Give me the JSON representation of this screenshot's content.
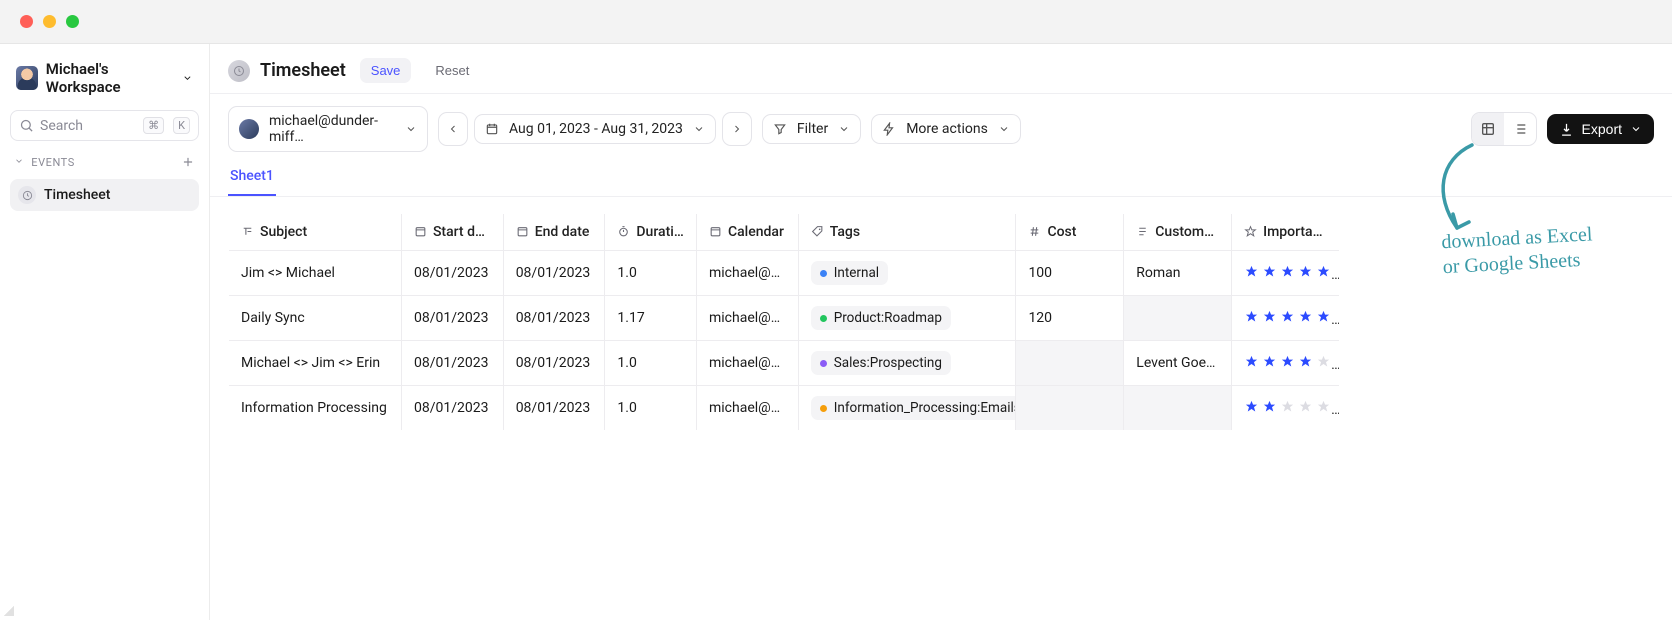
{
  "window": {
    "title": ""
  },
  "sidebar": {
    "workspace": "Michael's Workspace",
    "search_placeholder": "Search",
    "shortcut_mod": "⌘",
    "shortcut_key": "K",
    "section_label": "EVENTS",
    "items": [
      {
        "label": "Timesheet"
      }
    ]
  },
  "header": {
    "page_title": "Timesheet",
    "save_label": "Save",
    "reset_label": "Reset"
  },
  "toolbar": {
    "account": "michael@dunder-miff…",
    "date_range": "Aug 01, 2023 - Aug 31, 2023",
    "filter_label": "Filter",
    "more_label": "More actions",
    "export_label": "Export"
  },
  "tabs": {
    "active": "Sheet1"
  },
  "columns": {
    "subject": "Subject",
    "start": "Start date",
    "end": "End date",
    "duration": "Duration",
    "calendar": "Calendar",
    "tags": "Tags",
    "cost": "Cost",
    "customer": "Customer…",
    "importance": "Importance"
  },
  "rows": [
    {
      "subject": "Jim <> Michael",
      "start": "08/01/2023",
      "end": "08/01/2023",
      "duration": "1.0",
      "calendar": "michael@du…",
      "tag": {
        "label": "Internal",
        "color": "dot-blue"
      },
      "cost": "100",
      "customer": "Roman",
      "importance": 5
    },
    {
      "subject": "Daily Sync",
      "start": "08/01/2023",
      "end": "08/01/2023",
      "duration": "1.17",
      "calendar": "michael@du…",
      "tag": {
        "label": "Product:Roadmap",
        "color": "dot-green"
      },
      "cost": "120",
      "customer": "",
      "importance": 5
    },
    {
      "subject": "Michael <> Jim <> Erin",
      "start": "08/01/2023",
      "end": "08/01/2023",
      "duration": "1.0",
      "calendar": "michael@du…",
      "tag": {
        "label": "Sales:Prospecting",
        "color": "dot-purple"
      },
      "cost": "",
      "customer": "Levent Goebel",
      "importance": 4
    },
    {
      "subject": "Information Processing",
      "start": "08/01/2023",
      "end": "08/01/2023",
      "duration": "1.0",
      "calendar": "michael@du…",
      "tag": {
        "label": "Information_Processing:Emails",
        "color": "dot-amber"
      },
      "cost": "",
      "customer": "",
      "importance": 2
    }
  ],
  "annotation": {
    "line1": "download as Excel",
    "line2": "or Google Sheets"
  }
}
